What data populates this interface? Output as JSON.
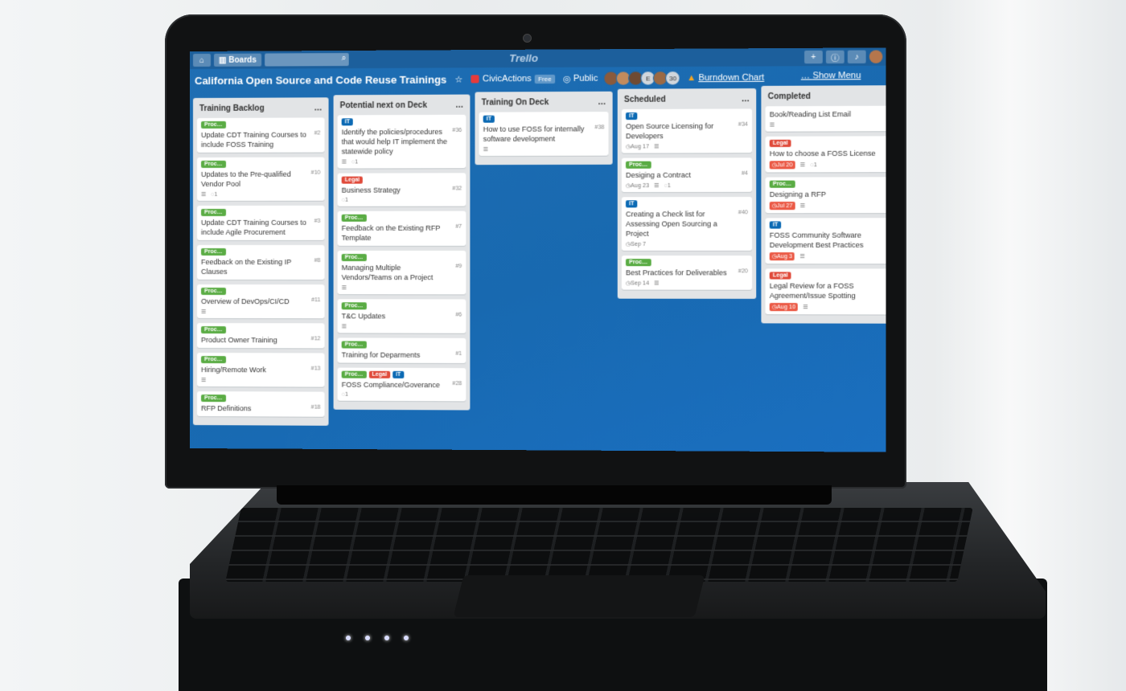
{
  "colors": {
    "board_bg": "#1a6ab0",
    "label_proc": "#5aac44",
    "label_legal": "#e04b3b",
    "label_it": "#0c6ab4",
    "due_overdue": "#eb5a46"
  },
  "topbar": {
    "home_icon": "home-icon",
    "boards_label": "Boards",
    "search_icon": "search-icon",
    "logo": "Trello",
    "add_icon": "plus-icon",
    "info_icon": "info-icon",
    "bell_icon": "bell-icon"
  },
  "board": {
    "title": "California Open Source and Code Reuse Trainings",
    "star_icon": "star-icon",
    "org": "CivicActions",
    "org_badge": "Free",
    "visibility": "Public",
    "member_initial": "E",
    "member_count": "30",
    "burndown": "Burndown Chart",
    "show_menu": "Show Menu"
  },
  "lists": [
    {
      "name": "Training Backlog",
      "cards": [
        {
          "labels": [
            {
              "text": "Proc…",
              "color": "#5aac44"
            }
          ],
          "title": "Update CDT Training Courses to include FOSS Training",
          "num": "#2",
          "badges": []
        },
        {
          "labels": [
            {
              "text": "Proc…",
              "color": "#5aac44"
            }
          ],
          "title": "Updates to the Pre-qualified Vendor Pool",
          "num": "#10",
          "badges": [
            {
              "type": "desc"
            },
            {
              "type": "comment",
              "text": "1"
            }
          ]
        },
        {
          "labels": [
            {
              "text": "Proc…",
              "color": "#5aac44"
            }
          ],
          "title": "Update CDT Training Courses to include Agile Procurement",
          "num": "#3",
          "badges": []
        },
        {
          "labels": [
            {
              "text": "Proc…",
              "color": "#5aac44"
            }
          ],
          "title": "Feedback on the Existing IP Clauses",
          "num": "#8",
          "badges": []
        },
        {
          "labels": [
            {
              "text": "Proc…",
              "color": "#5aac44"
            }
          ],
          "title": "Overview of DevOps/CI/CD",
          "num": "#11",
          "badges": [
            {
              "type": "desc"
            }
          ]
        },
        {
          "labels": [
            {
              "text": "Proc…",
              "color": "#5aac44"
            }
          ],
          "title": "Product Owner Training",
          "num": "#12",
          "badges": []
        },
        {
          "labels": [
            {
              "text": "Proc…",
              "color": "#5aac44"
            }
          ],
          "title": "Hiring/Remote Work",
          "num": "#13",
          "badges": [
            {
              "type": "desc"
            }
          ]
        },
        {
          "labels": [
            {
              "text": "Proc…",
              "color": "#5aac44"
            }
          ],
          "title": "RFP Definitions",
          "num": "#18",
          "badges": []
        }
      ]
    },
    {
      "name": "Potential next on Deck",
      "cards": [
        {
          "labels": [
            {
              "text": "IT",
              "color": "#0c6ab4"
            }
          ],
          "title": "Identify the policies/procedures that would help IT implement the statewide policy",
          "num": "#36",
          "badges": [
            {
              "type": "desc"
            },
            {
              "type": "comment",
              "text": "1"
            }
          ]
        },
        {
          "labels": [
            {
              "text": "Legal",
              "color": "#e04b3b"
            }
          ],
          "title": "Business Strategy",
          "num": "#32",
          "badges": [
            {
              "type": "comment",
              "text": "1"
            }
          ]
        },
        {
          "labels": [
            {
              "text": "Proc…",
              "color": "#5aac44"
            }
          ],
          "title": "Feedback on the Existing RFP Template",
          "num": "#7",
          "badges": []
        },
        {
          "labels": [
            {
              "text": "Proc…",
              "color": "#5aac44"
            }
          ],
          "title": "Managing Multiple Vendors/Teams on a Project",
          "num": "#9",
          "badges": [
            {
              "type": "desc"
            }
          ]
        },
        {
          "labels": [
            {
              "text": "Proc…",
              "color": "#5aac44"
            }
          ],
          "title": "T&C Updates",
          "num": "#6",
          "badges": [
            {
              "type": "desc"
            }
          ]
        },
        {
          "labels": [
            {
              "text": "Proc…",
              "color": "#5aac44"
            }
          ],
          "title": "Training for Deparments",
          "num": "#1",
          "badges": []
        },
        {
          "labels": [
            {
              "text": "Proc…",
              "color": "#5aac44"
            },
            {
              "text": "Legal",
              "color": "#e04b3b"
            },
            {
              "text": "IT",
              "color": "#0c6ab4"
            }
          ],
          "title": "FOSS Compliance/Goverance",
          "num": "#28",
          "badges": [
            {
              "type": "comment",
              "text": "1"
            }
          ]
        }
      ]
    },
    {
      "name": "Training On Deck",
      "cards": [
        {
          "labels": [
            {
              "text": "IT",
              "color": "#0c6ab4"
            }
          ],
          "title": "How to use FOSS for internally software development",
          "num": "#38",
          "badges": [
            {
              "type": "desc"
            }
          ]
        }
      ]
    },
    {
      "name": "Scheduled",
      "cards": [
        {
          "labels": [
            {
              "text": "IT",
              "color": "#0c6ab4"
            }
          ],
          "title": "Open Source Licensing for Developers",
          "num": "#34",
          "badges": [
            {
              "type": "due",
              "text": "Aug 17"
            },
            {
              "type": "desc"
            }
          ]
        },
        {
          "labels": [
            {
              "text": "Proc…",
              "color": "#5aac44"
            }
          ],
          "title": "Desiging a Contract",
          "num": "#4",
          "badges": [
            {
              "type": "due",
              "text": "Aug 23"
            },
            {
              "type": "desc"
            },
            {
              "type": "comment",
              "text": "1"
            }
          ]
        },
        {
          "labels": [
            {
              "text": "IT",
              "color": "#0c6ab4"
            }
          ],
          "title": "Creating a Check list for Assessing Open Sourcing a Project",
          "num": "#40",
          "badges": [
            {
              "type": "due",
              "text": "Sep 7"
            }
          ]
        },
        {
          "labels": [
            {
              "text": "Proc…",
              "color": "#5aac44"
            }
          ],
          "title": "Best Practices for Deliverables",
          "num": "#20",
          "badges": [
            {
              "type": "due",
              "text": "Sep 14"
            },
            {
              "type": "desc"
            }
          ]
        }
      ]
    },
    {
      "name": "Completed",
      "cards": [
        {
          "labels": [],
          "title": "Book/Reading List Email",
          "num": "",
          "badges": [
            {
              "type": "desc"
            }
          ]
        },
        {
          "labels": [
            {
              "text": "Legal",
              "color": "#e04b3b"
            }
          ],
          "title": "How to choose a FOSS License",
          "num": "",
          "badges": [
            {
              "type": "overdue",
              "text": "Jul 20"
            },
            {
              "type": "desc"
            },
            {
              "type": "comment",
              "text": "1"
            }
          ]
        },
        {
          "labels": [
            {
              "text": "Proc…",
              "color": "#5aac44"
            }
          ],
          "title": "Designing a RFP",
          "num": "",
          "badges": [
            {
              "type": "overdue",
              "text": "Jul 27"
            },
            {
              "type": "desc"
            }
          ]
        },
        {
          "labels": [
            {
              "text": "IT",
              "color": "#0c6ab4"
            }
          ],
          "title": "FOSS Community Software Development Best Practices",
          "num": "",
          "badges": [
            {
              "type": "overdue",
              "text": "Aug 3"
            },
            {
              "type": "desc"
            }
          ]
        },
        {
          "labels": [
            {
              "text": "Legal",
              "color": "#e04b3b"
            }
          ],
          "title": "Legal Review for a FOSS Agreement/Issue Spotting",
          "num": "",
          "badges": [
            {
              "type": "overdue",
              "text": "Aug 10"
            },
            {
              "type": "desc"
            }
          ]
        }
      ]
    }
  ]
}
